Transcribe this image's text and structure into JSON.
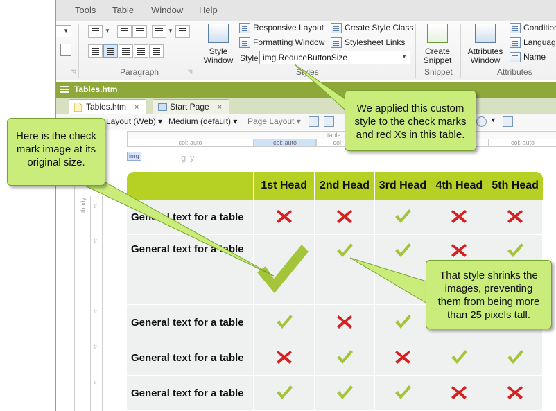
{
  "menu": [
    "Tools",
    "Table",
    "Window",
    "Help"
  ],
  "ribbon": {
    "groups": {
      "paragraph": "Paragraph",
      "styles": "Styles",
      "snippet": "Snippet",
      "attributes": "Attributes"
    },
    "style_window": [
      "Style",
      "Window"
    ],
    "responsive_layout": "Responsive Layout",
    "formatting_window": "Formatting Window",
    "create_style_class": "Create Style Class",
    "stylesheet_links": "Stylesheet Links",
    "style_label": "Style",
    "style_value": "img.ReduceButtonSize",
    "create_snippet": [
      "Create",
      "Snippet"
    ],
    "attributes_window": [
      "Attributes",
      "Window"
    ],
    "conditions": "Condition",
    "language": "Language",
    "name": "Name"
  },
  "title_strip": "Tables.htm",
  "tabs": [
    {
      "label": "Tables.htm",
      "close": "×"
    },
    {
      "label": "Start Page",
      "close": "×"
    }
  ],
  "toolbar": {
    "layout": "Layout (Web)",
    "medium": "Medium (default)",
    "page_layout": "Page Layout"
  },
  "ruler": {
    "table": "table: auto",
    "col": "col: auto"
  },
  "gutter": {
    "tbody": "tbody",
    "tr": "tr",
    "img": "img"
  },
  "clipped_text": "g                                                      y",
  "table": {
    "headers": [
      "",
      "1st Head",
      "2nd Head",
      "3rd Head",
      "4th Head",
      "5th Head"
    ],
    "rows": [
      {
        "label": "General text for a table",
        "cells": [
          "x",
          "x",
          "check",
          "x",
          "x"
        ]
      },
      {
        "label": "General text for a table",
        "cells": [
          "bigcheck",
          "check",
          "check",
          "x",
          "check"
        ]
      },
      {
        "label": "General text for a table",
        "cells": [
          "check",
          "x",
          "check",
          "",
          ""
        ]
      },
      {
        "label": "General text for a table",
        "cells": [
          "x",
          "check",
          "x",
          "check",
          "check"
        ]
      },
      {
        "label": "General text for a table",
        "cells": [
          "check",
          "check",
          "check",
          "x",
          "x"
        ]
      }
    ]
  },
  "callouts": {
    "left": "Here is the check mark image at its original size.",
    "top": "We applied this custom style to the check marks and red Xs in this table.",
    "right": "That style shrinks the images, preventing them from being more than 25 pixels tall."
  },
  "colors": {
    "accent": "#8fa83a",
    "header": "#b6d024",
    "callout": "#c9ec7a",
    "check": "#a4c439",
    "x": "#d42020"
  }
}
